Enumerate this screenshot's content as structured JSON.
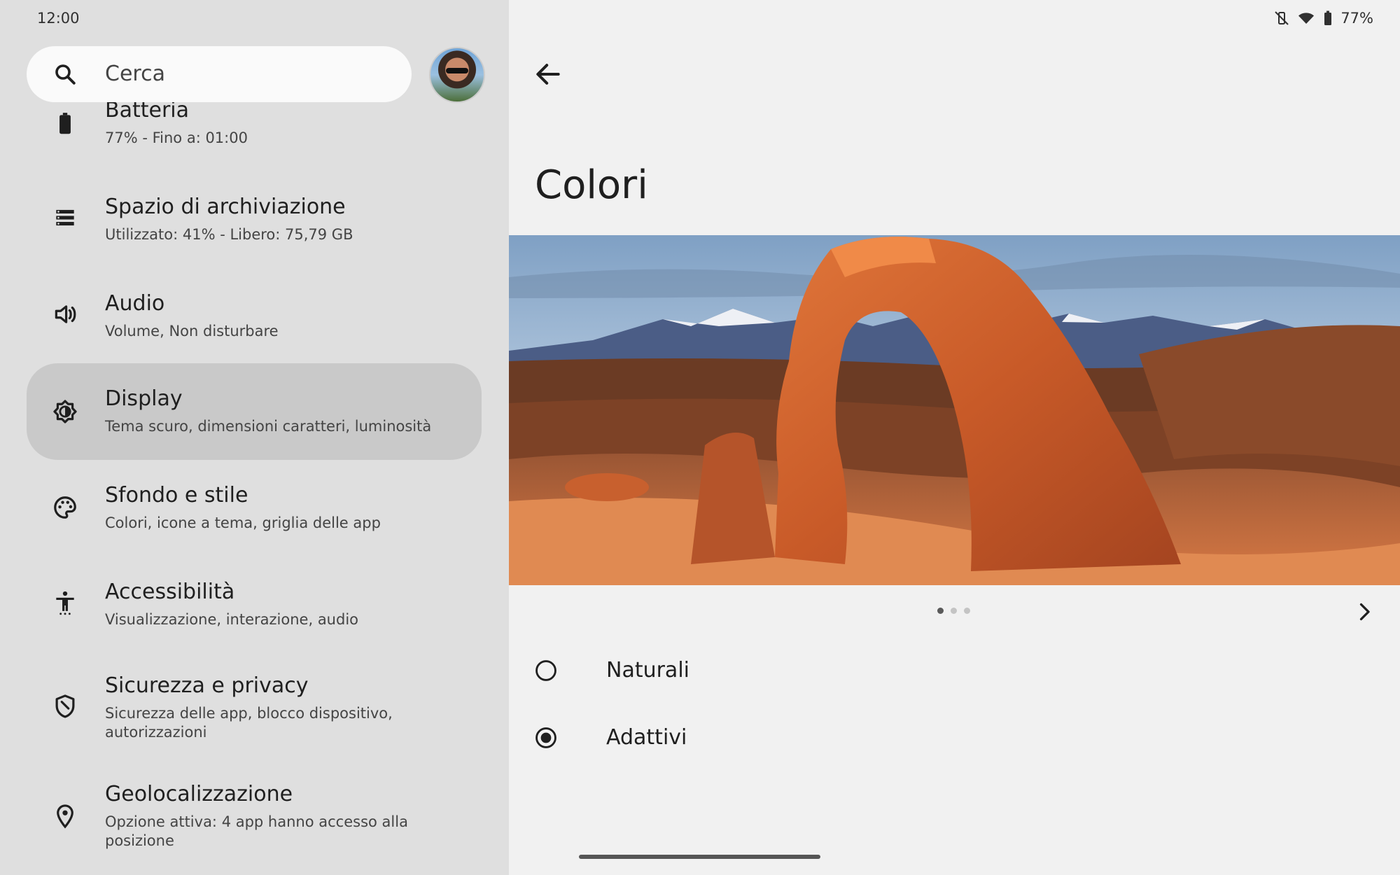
{
  "status_bar": {
    "time": "12:00",
    "battery_percent": "77%"
  },
  "search": {
    "placeholder": "Cerca"
  },
  "settings_list": [
    {
      "key": "battery",
      "title": "Batteria",
      "subtitle": "77% - Fino a: 01:00",
      "icon": "battery-icon"
    },
    {
      "key": "storage",
      "title": "Spazio di archiviazione",
      "subtitle": "Utilizzato: 41% - Libero: 75,79 GB",
      "icon": "storage-icon"
    },
    {
      "key": "audio",
      "title": "Audio",
      "subtitle": "Volume, Non disturbare",
      "icon": "volume-icon"
    },
    {
      "key": "display",
      "title": "Display",
      "subtitle": "Tema scuro, dimensioni caratteri, luminosità",
      "icon": "brightness-icon",
      "selected": true
    },
    {
      "key": "wallpaper",
      "title": "Sfondo e stile",
      "subtitle": "Colori, icone a tema, griglia delle app",
      "icon": "palette-icon"
    },
    {
      "key": "accessibility",
      "title": "Accessibilità",
      "subtitle": "Visualizzazione, interazione, audio",
      "icon": "accessibility-icon"
    },
    {
      "key": "security",
      "title": "Sicurezza e privacy",
      "subtitle": "Sicurezza delle app, blocco dispositivo, autorizzazioni",
      "icon": "shield-icon"
    },
    {
      "key": "location",
      "title": "Geolocalizzazione",
      "subtitle": "Opzione attiva: 4 app hanno accesso alla posizione",
      "icon": "location-pin-icon"
    }
  ],
  "detail": {
    "title": "Colori",
    "carousel": {
      "pages": 3,
      "active_index": 0
    },
    "options": [
      {
        "label": "Naturali",
        "checked": false
      },
      {
        "label": "Adattivi",
        "checked": true
      }
    ]
  },
  "colors": {
    "left_pane": "#dfdfdf",
    "right_pane": "#f1f1f1",
    "selected_item": "#c9c9c9"
  }
}
